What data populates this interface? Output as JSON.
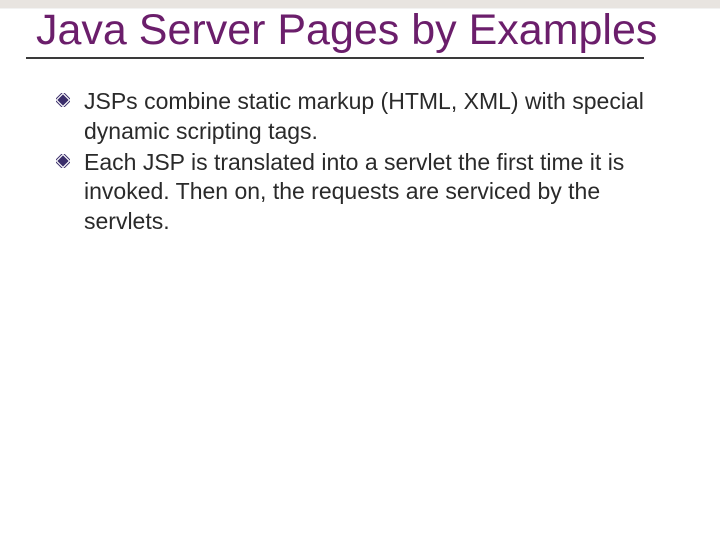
{
  "slide": {
    "title": "Java Server Pages by Examples",
    "bullets": [
      "JSPs combine static markup (HTML, XML) with special dynamic scripting tags.",
      "Each JSP is translated into a servlet the first time it is invoked. Then on, the requests are serviced by the servlets."
    ]
  }
}
